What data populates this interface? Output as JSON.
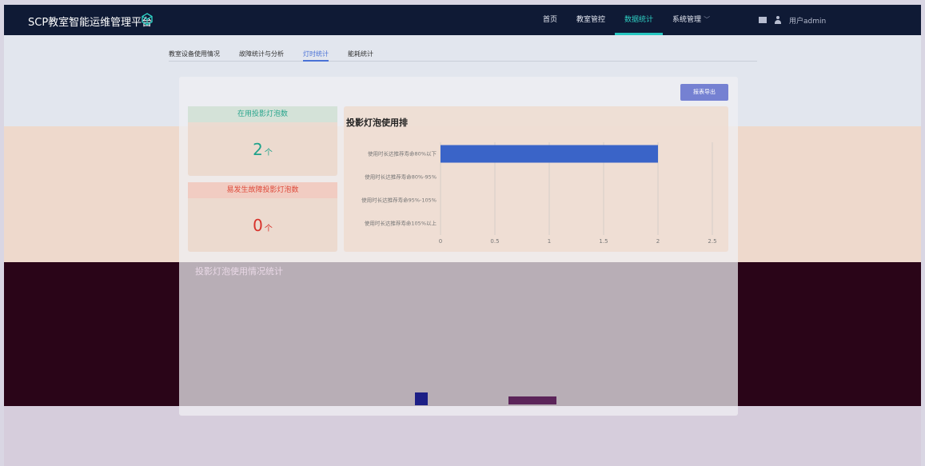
{
  "header": {
    "brand": "SCP教室智能运维管理平台",
    "nav": [
      {
        "label": "首页",
        "active": false
      },
      {
        "label": "教室管控",
        "active": false
      },
      {
        "label": "数据统计",
        "active": true
      },
      {
        "label": "系统管理",
        "active": false,
        "has_dropdown": true
      }
    ],
    "user": "用户admin",
    "icons": [
      "cube-icon",
      "mail-icon",
      "user-icon"
    ]
  },
  "subtabs": [
    {
      "label": "教室设备使用情况",
      "active": false
    },
    {
      "label": "故障统计与分析",
      "active": false
    },
    {
      "label": "灯时统计",
      "active": true
    },
    {
      "label": "能耗统计",
      "active": false
    }
  ],
  "toolbar": {
    "export_label": "报表导出"
  },
  "stats": {
    "in_use": {
      "title": "在用投影灯泡数",
      "value": "2",
      "unit": "个"
    },
    "fault_prone": {
      "title": "易发生故障投影灯泡数",
      "value": "0",
      "unit": "个"
    }
  },
  "chart_panel": {
    "title": "投影灯泡使用排"
  },
  "lower_panel": {
    "title": "投影灯泡使用情况统计"
  },
  "colors": {
    "accent": "#26c6c0",
    "bar": "#3a64c8",
    "export_button": "#7581d2",
    "topbar": "#0f1a35"
  },
  "chart_data": {
    "type": "bar",
    "orientation": "horizontal",
    "categories": [
      "使用时长达推荐寿命80%以下",
      "使用时长达推荐寿命80%-95%",
      "使用时长达推荐寿命95%-105%",
      "使用时长达推荐寿命105%以上"
    ],
    "values": [
      2,
      0,
      0,
      0
    ],
    "xlim": [
      0,
      2.5
    ],
    "xticks": [
      "0",
      "0.5",
      "1",
      "1.5",
      "2",
      "2.5"
    ],
    "grid": true
  }
}
